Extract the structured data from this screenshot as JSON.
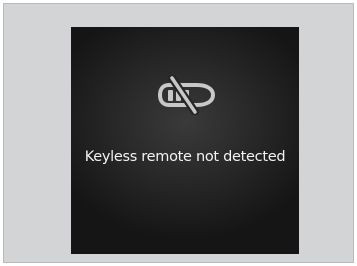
{
  "notification": {
    "icon": "keyless-remote-off-icon",
    "message": "Keyless remote not detected"
  },
  "colors": {
    "frame_background": "#d3d4d5",
    "display_background": "#262626",
    "icon": "#c8c8c8",
    "text": "#f2f2f2"
  }
}
